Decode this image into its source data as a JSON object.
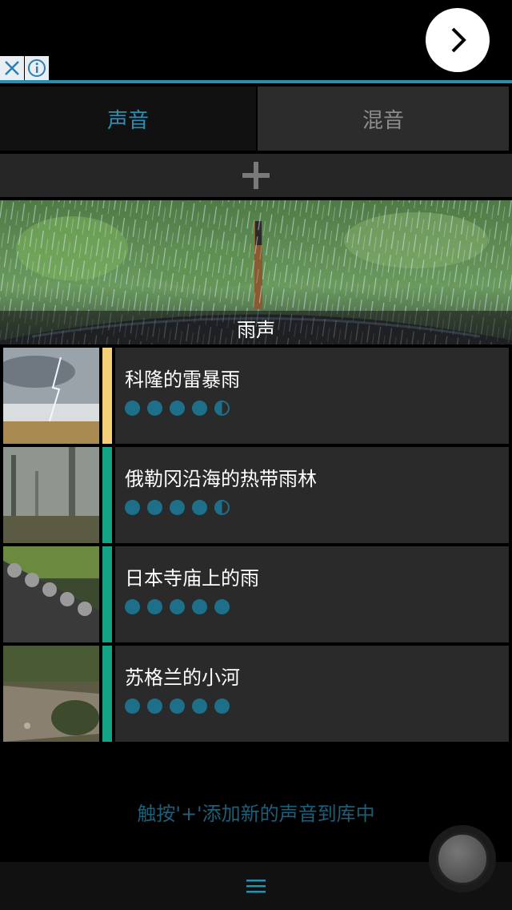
{
  "ad": {
    "next_icon": "chevron-right-icon",
    "close_icon": "close-icon",
    "info_icon": "info-icon"
  },
  "tabs": [
    {
      "label": "声音",
      "active": true
    },
    {
      "label": "混音",
      "active": false
    }
  ],
  "add_icon": "plus-icon",
  "banner": {
    "label": "雨声"
  },
  "items": [
    {
      "title": "科隆的雷暴雨",
      "rating": 4.5,
      "bar_color": "#f5cf78"
    },
    {
      "title": "俄勒冈沿海的热带雨林",
      "rating": 4.5,
      "bar_color": "#13a486"
    },
    {
      "title": "日本寺庙上的雨",
      "rating": 5,
      "bar_color": "#13a486"
    },
    {
      "title": "苏格兰的小河",
      "rating": 5,
      "bar_color": "#13a486"
    }
  ],
  "hint": "触按'+'添加新的声音到库中",
  "menu_icon": "hamburger-menu-icon",
  "colors": {
    "accent": "#2a8fb0",
    "dot": "#1d6f8a"
  }
}
